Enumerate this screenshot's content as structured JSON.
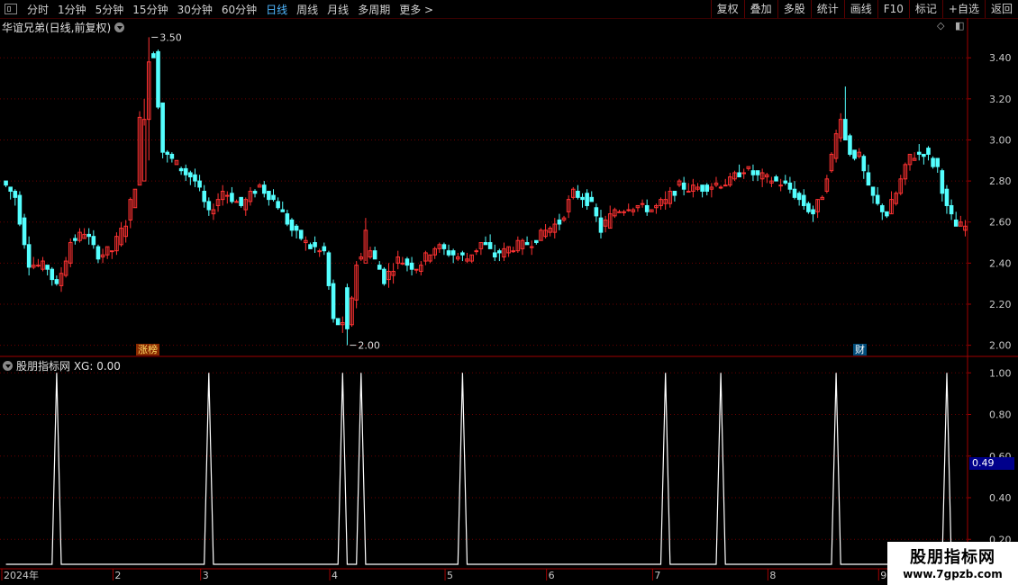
{
  "toolbar": {
    "periods": [
      "分时",
      "1分钟",
      "5分钟",
      "15分钟",
      "30分钟",
      "60分钟",
      "日线",
      "周线",
      "月线",
      "多周期",
      "更多 >"
    ],
    "active_period": "日线",
    "right_buttons": [
      "复权",
      "叠加",
      "多股",
      "统计",
      "画线",
      "F10",
      "标记",
      "+自选",
      "返回"
    ]
  },
  "main_chart": {
    "title": "华谊兄弟(日线,前复权)",
    "high_marker": "3.50",
    "low_marker": "2.00",
    "tag_zhangbang": "涨榜",
    "tag_cai": "财"
  },
  "indicator": {
    "title": "股朋指标网 XG: 0.00",
    "last_value_badge": "0.49"
  },
  "watermark": {
    "line1": "股朋指标网",
    "line2": "www.7gpzb.com"
  },
  "colors": {
    "up": "#ff3232",
    "down": "#54ffff",
    "grid": "#6b0000",
    "signal": "#ffffff",
    "badge": "#00008b"
  },
  "chart_data": [
    {
      "type": "candlestick",
      "title": "华谊兄弟(日线,前复权)",
      "ylim": [
        1.95,
        3.55
      ],
      "y_ticks": [
        2.0,
        2.2,
        2.4,
        2.6,
        2.8,
        3.0,
        3.2,
        3.4
      ],
      "y_tick_labels": [
        "2.00",
        "2.20",
        "2.40",
        "2.60",
        "2.80",
        "3.00",
        "3.20",
        "3.40"
      ],
      "annotations": [
        {
          "label": "3.50",
          "value": 3.5
        },
        {
          "label": "2.00",
          "value": 2.0
        }
      ],
      "x_labels": [
        "2024年",
        "2",
        "3",
        "4",
        "5",
        "6",
        "7",
        "8",
        "9"
      ],
      "x_label_index": [
        0,
        24,
        43,
        71,
        96,
        118,
        141,
        166,
        190
      ],
      "anchors": [
        [
          0,
          2.8
        ],
        [
          3,
          2.72
        ],
        [
          6,
          2.4
        ],
        [
          10,
          2.38
        ],
        [
          12,
          2.28
        ],
        [
          15,
          2.5
        ],
        [
          18,
          2.55
        ],
        [
          21,
          2.44
        ],
        [
          24,
          2.46
        ],
        [
          27,
          2.6
        ],
        [
          29,
          2.78
        ],
        [
          31,
          3.4
        ],
        [
          33,
          3.42
        ],
        [
          35,
          2.94
        ],
        [
          38,
          2.88
        ],
        [
          42,
          2.8
        ],
        [
          45,
          2.64
        ],
        [
          48,
          2.75
        ],
        [
          52,
          2.68
        ],
        [
          56,
          2.78
        ],
        [
          60,
          2.68
        ],
        [
          63,
          2.56
        ],
        [
          67,
          2.48
        ],
        [
          70,
          2.45
        ],
        [
          72,
          2.12
        ],
        [
          75,
          2.08
        ],
        [
          77,
          2.4
        ],
        [
          80,
          2.46
        ],
        [
          83,
          2.32
        ],
        [
          86,
          2.42
        ],
        [
          90,
          2.38
        ],
        [
          94,
          2.48
        ],
        [
          98,
          2.44
        ],
        [
          101,
          2.42
        ],
        [
          104,
          2.5
        ],
        [
          107,
          2.44
        ],
        [
          111,
          2.48
        ],
        [
          115,
          2.5
        ],
        [
          118,
          2.56
        ],
        [
          121,
          2.6
        ],
        [
          124,
          2.74
        ],
        [
          126,
          2.72
        ],
        [
          128,
          2.68
        ],
        [
          130,
          2.56
        ],
        [
          133,
          2.66
        ],
        [
          137,
          2.68
        ],
        [
          141,
          2.66
        ],
        [
          144,
          2.7
        ],
        [
          147,
          2.78
        ],
        [
          150,
          2.76
        ],
        [
          154,
          2.78
        ],
        [
          158,
          2.8
        ],
        [
          161,
          2.86
        ],
        [
          164,
          2.82
        ],
        [
          168,
          2.8
        ],
        [
          171,
          2.76
        ],
        [
          174,
          2.68
        ],
        [
          176,
          2.64
        ],
        [
          178,
          2.74
        ],
        [
          180,
          2.92
        ],
        [
          182,
          3.12
        ],
        [
          184,
          2.94
        ],
        [
          186,
          2.92
        ],
        [
          188,
          2.76
        ],
        [
          190,
          2.68
        ],
        [
          192,
          2.64
        ],
        [
          194,
          2.74
        ],
        [
          197,
          2.92
        ],
        [
          200,
          2.94
        ],
        [
          203,
          2.86
        ],
        [
          205,
          2.66
        ],
        [
          207,
          2.58
        ]
      ],
      "values": {
        "open": [],
        "high": [],
        "low": [],
        "close": []
      }
    },
    {
      "type": "line",
      "title": "股朋指标网 XG: 0.00",
      "series": [
        {
          "name": "XG",
          "values": []
        }
      ],
      "ylim": [
        0.08,
        1.04
      ],
      "y_ticks": [
        0.2,
        0.4,
        0.6,
        0.8,
        1.0
      ],
      "y_tick_labels": [
        "0.20",
        "0.40",
        "0.60",
        "0.80",
        "1.00"
      ],
      "current_value": "0.49",
      "signal_indices": [
        11,
        44,
        73,
        77,
        99,
        143,
        155,
        180,
        204
      ]
    }
  ]
}
